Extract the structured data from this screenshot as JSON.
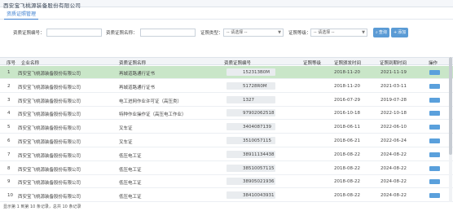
{
  "window": {
    "title": "西安宝飞桃源装备股份有限公司"
  },
  "tabs": [
    {
      "label": "资质证照管理"
    }
  ],
  "filters": {
    "cert_no_label": "资质证照编号：",
    "cert_name_label": "资质证照名称：",
    "cert_type_label": "证照类型：",
    "cert_type_value": "-- 请选择 --",
    "cert_level_label": "证照等级：",
    "cert_level_value": "-- 请选择 --",
    "query_label": "查询",
    "add_label": "添加"
  },
  "table": {
    "headers": [
      "序号",
      "企业名称",
      "资质证照名称",
      "资质证照编号",
      "证照等级",
      "证照颁发时间",
      "证照到期时间",
      "操作"
    ],
    "rows": [
      {
        "no": "1",
        "company": "西安宝飞桃源装备股份有限公司",
        "name": "再城道路通行证书",
        "code": "152313B0M",
        "level": "",
        "issued": "2018-11-20",
        "expires": "2021-11-19"
      },
      {
        "no": "2",
        "company": "西安宝飞桃源装备股份有限公司",
        "name": "再城道路通行证书",
        "code": "51728R0M",
        "level": "",
        "issued": "2018-11-20",
        "expires": "2021-03-11"
      },
      {
        "no": "3",
        "company": "西安宝飞桃源装备股份有限公司",
        "name": "电工进网作业许可证（高压类）",
        "code": "1327",
        "level": "",
        "issued": "2016-07-29",
        "expires": "2019-07-28"
      },
      {
        "no": "4",
        "company": "西安宝飞桃源装备股份有限公司",
        "name": "特种作业操作证（高压电工作业）",
        "code": "97902062518",
        "level": "",
        "issued": "2016-10-18",
        "expires": "2022-10-18"
      },
      {
        "no": "5",
        "company": "西安宝飞桃源装备股份有限公司",
        "name": "叉车证",
        "code": "3404087139",
        "level": "",
        "issued": "2018-06-11",
        "expires": "2022-06-10"
      },
      {
        "no": "6",
        "company": "西安宝飞桃源装备股份有限公司",
        "name": "叉车证",
        "code": "3510057115",
        "level": "",
        "issued": "2018-06-21",
        "expires": "2022-06-24"
      },
      {
        "no": "7",
        "company": "西安宝飞桃源装备股份有限公司",
        "name": "低压电工证",
        "code": "38911134438",
        "level": "",
        "issued": "2018-08-22",
        "expires": "2024-08-22"
      },
      {
        "no": "8",
        "company": "西安宝飞桃源装备股份有限公司",
        "name": "低压电工证",
        "code": "38510057115",
        "level": "",
        "issued": "2018-08-22",
        "expires": "2024-08-22"
      },
      {
        "no": "9",
        "company": "西安宝飞桃源装备股份有限公司",
        "name": "低压电工证",
        "code": "38905021936",
        "level": "",
        "issued": "2018-08-22",
        "expires": "2024-08-22"
      },
      {
        "no": "10",
        "company": "西安宝飞桃源装备股份有限公司",
        "name": "低压电工证",
        "code": "38410043931",
        "level": "",
        "issued": "2018-08-22",
        "expires": "2024-08-22"
      }
    ]
  },
  "footer": {
    "text": "显示第 1 到第 10 条记录，总共 10 条记录"
  },
  "colors": {
    "accent": "#5b9bd5",
    "highlight_row": "#c9e6c8"
  }
}
